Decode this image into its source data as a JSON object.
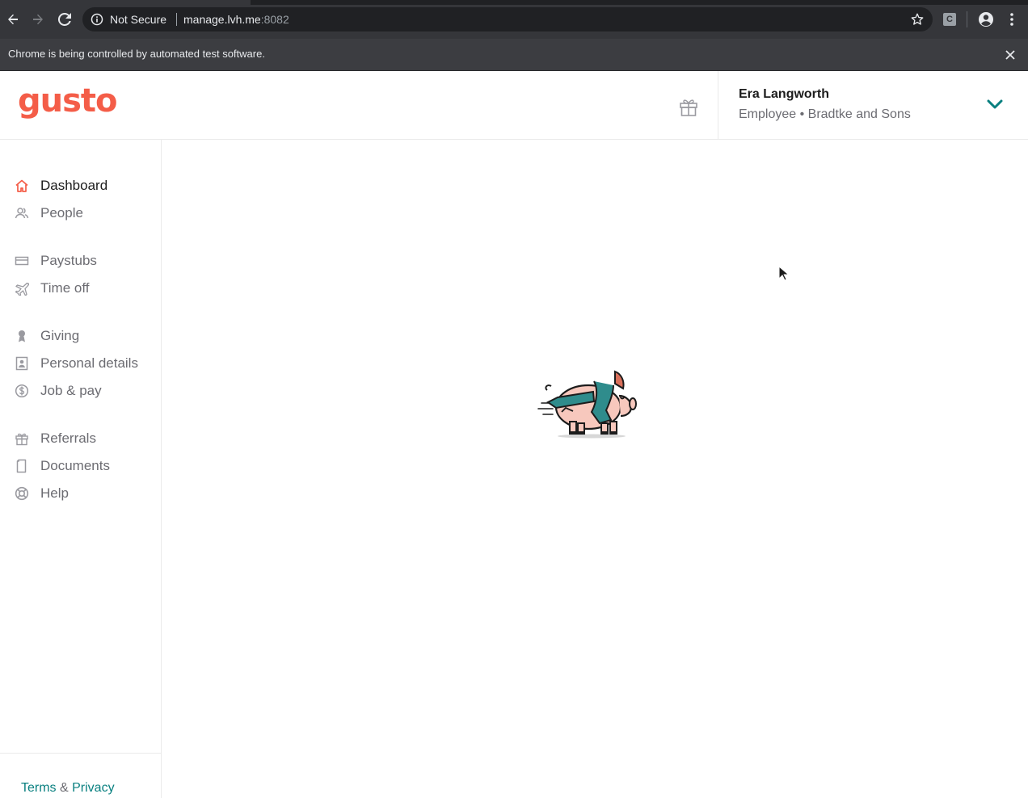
{
  "browser": {
    "security_label": "Not Secure",
    "url_host": "manage.lvh.me",
    "url_port": ":8082",
    "extension_label": "C",
    "automation_message": "Chrome is being controlled by automated test software."
  },
  "header": {
    "logo": "gusto",
    "user_name": "Era Langworth",
    "user_role": "Employee • Bradtke and Sons"
  },
  "sidebar": {
    "items": [
      {
        "label": "Dashboard",
        "icon": "home-icon",
        "active": true
      },
      {
        "label": "People",
        "icon": "people-icon"
      },
      {
        "label": "Paystubs",
        "icon": "paystub-icon"
      },
      {
        "label": "Time off",
        "icon": "plane-icon"
      },
      {
        "label": "Giving",
        "icon": "ribbon-icon"
      },
      {
        "label": "Personal details",
        "icon": "id-card-icon"
      },
      {
        "label": "Job & pay",
        "icon": "dollar-icon"
      },
      {
        "label": "Referrals",
        "icon": "gift-icon"
      },
      {
        "label": "Documents",
        "icon": "document-icon"
      },
      {
        "label": "Help",
        "icon": "lifebuoy-icon"
      }
    ],
    "footer": {
      "terms": "Terms",
      "amp": " & ",
      "privacy": "Privacy"
    }
  },
  "colors": {
    "brand": "#f45d48",
    "link": "#0a8080",
    "scarf": "#2f8c8c"
  }
}
